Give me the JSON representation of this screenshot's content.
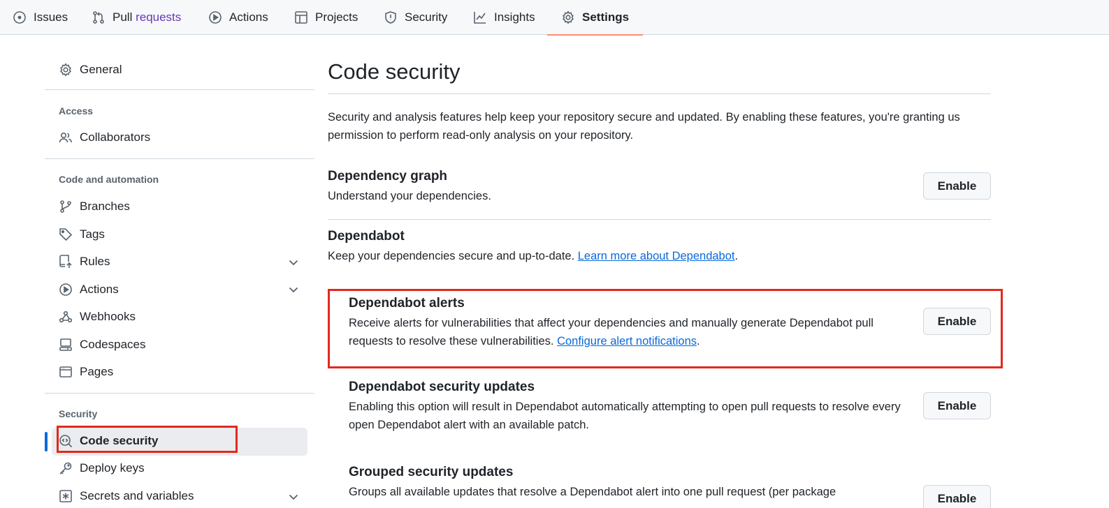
{
  "nav": {
    "tabs": [
      {
        "label": "Issues",
        "icon": "issue-opened-icon"
      },
      {
        "label_main": "Pull ",
        "label_sub": "requests",
        "icon": "git-pull-request-icon"
      },
      {
        "label": "Actions",
        "icon": "play-icon"
      },
      {
        "label": "Projects",
        "icon": "table-icon"
      },
      {
        "label": "Security",
        "icon": "shield-icon"
      },
      {
        "label": "Insights",
        "icon": "graph-icon"
      },
      {
        "label": "Settings",
        "icon": "gear-icon",
        "active": true
      }
    ]
  },
  "sidebar": {
    "general": "General",
    "access_heading": "Access",
    "collaborators": "Collaborators",
    "code_heading": "Code and automation",
    "branches": "Branches",
    "tags": "Tags",
    "rules": "Rules",
    "actions": "Actions",
    "webhooks": "Webhooks",
    "codespaces": "Codespaces",
    "pages": "Pages",
    "security_heading": "Security",
    "code_security": "Code security",
    "deploy_keys": "Deploy keys",
    "secrets": "Secrets and variables"
  },
  "main": {
    "title": "Code security",
    "intro": "Security and analysis features help keep your repository secure and updated. By enabling these features, you're granting us permission to perform read-only analysis on your repository.",
    "dependency_graph": {
      "title": "Dependency graph",
      "desc": "Understand your dependencies.",
      "button": "Enable"
    },
    "dependabot": {
      "title": "Dependabot",
      "desc": "Keep your dependencies secure and up-to-date. ",
      "link": "Learn more about Dependabot",
      "after": "."
    },
    "alerts": {
      "title": "Dependabot alerts",
      "desc": "Receive alerts for vulnerabilities that affect your dependencies and manually generate Dependabot pull requests to resolve these vulnerabilities. ",
      "link": "Configure alert notifications",
      "after": ".",
      "button": "Enable"
    },
    "security_updates": {
      "title": "Dependabot security updates",
      "desc": "Enabling this option will result in Dependabot automatically attempting to open pull requests to resolve every open Dependabot alert with an available patch.",
      "button": "Enable"
    },
    "grouped": {
      "title": "Grouped security updates",
      "desc": "Groups all available updates that resolve a Dependabot alert into one pull request (per package",
      "button": "Enable"
    }
  },
  "colors": {
    "accent_link": "#0969da",
    "active_tab_underline": "#fd8c73",
    "highlight_box": "#e2291b"
  }
}
